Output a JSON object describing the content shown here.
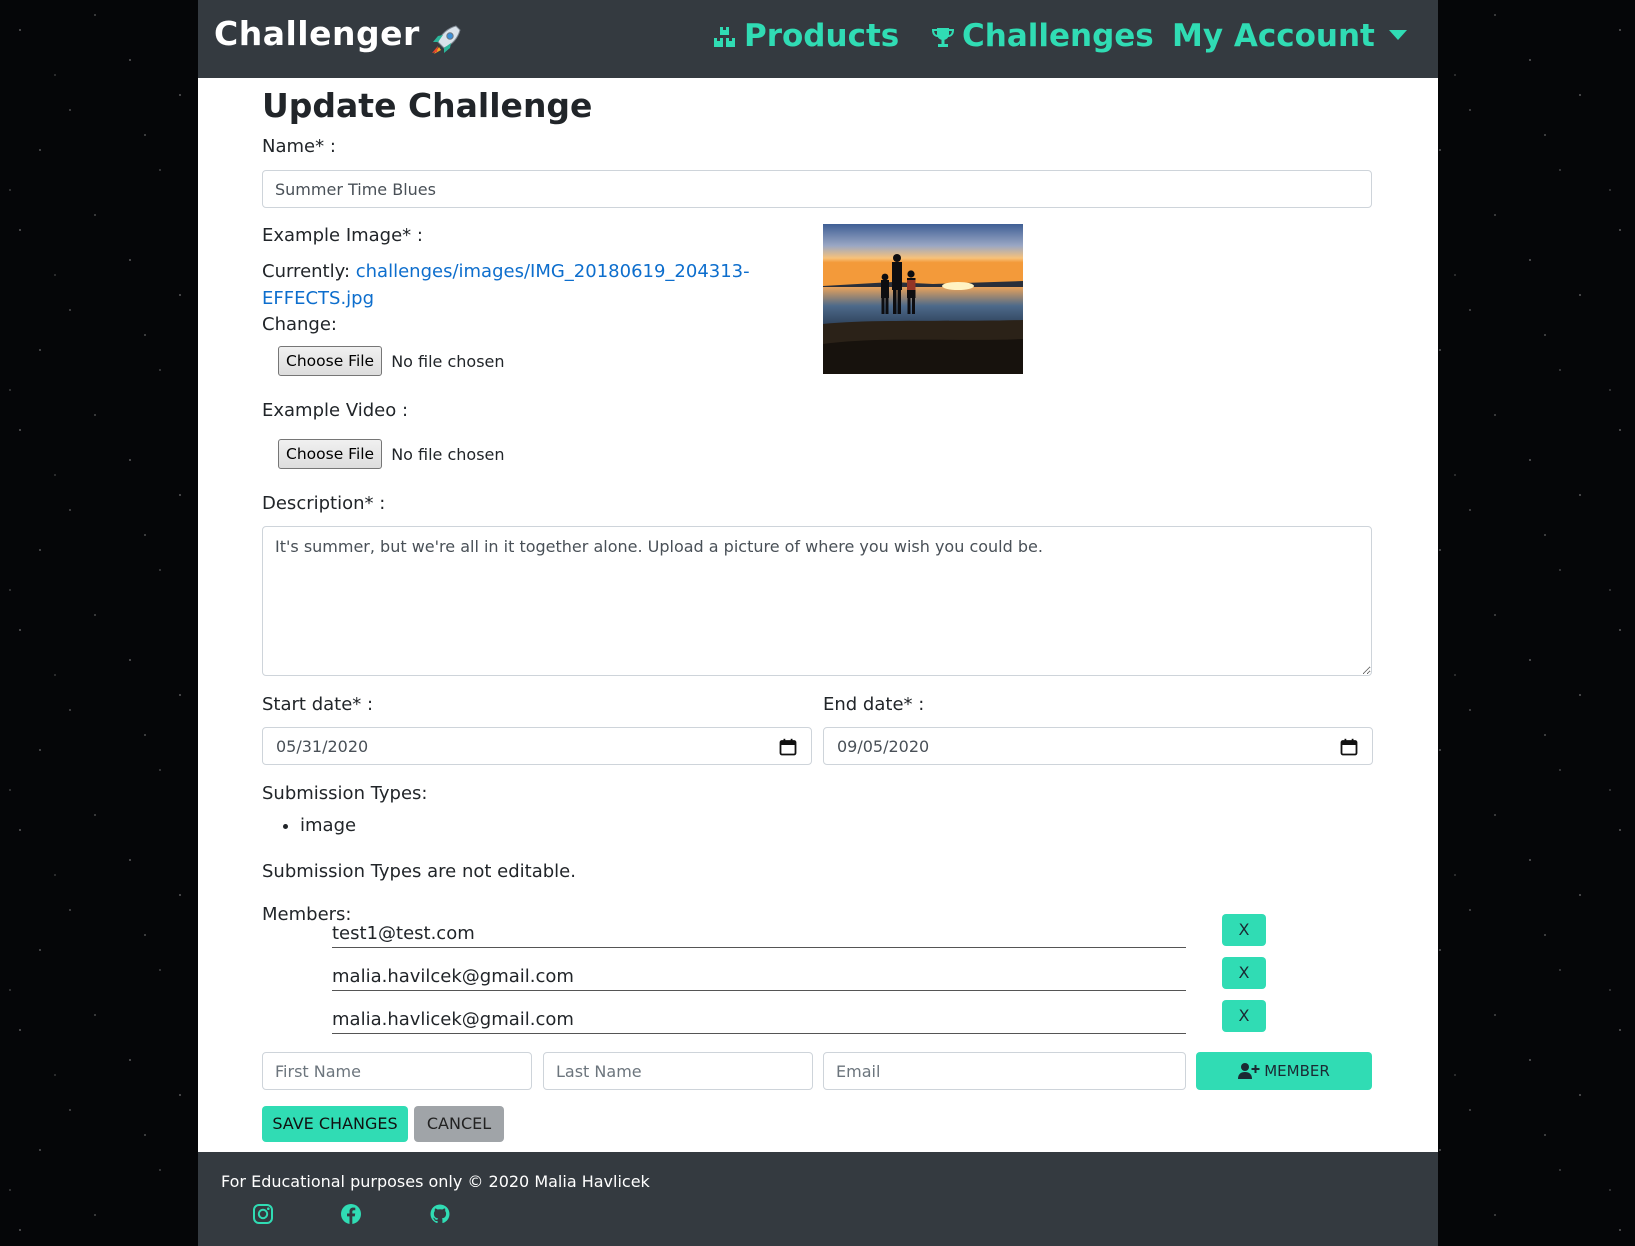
{
  "navbar": {
    "brand": "Challenger",
    "brand_icon": "rocket-icon",
    "links": {
      "products": "Products",
      "challenges": "Challenges",
      "account": "My Account"
    }
  },
  "page_title": "Update Challenge",
  "form": {
    "name_label": "Name* :",
    "name_value": "Summer Time Blues",
    "image_label": "Example Image* :",
    "currently_label": "Currently:",
    "currently_link": "challenges/images/IMG_20180619_204313-EFFECTS.jpg",
    "change_label": "Change:",
    "choose_file": "Choose File",
    "no_file": "No file chosen",
    "video_label": "Example Video :",
    "description_label": "Description* :",
    "description_value": "It's summer, but we're all in it together alone. Upload a picture of where you wish you could be.",
    "start_label": "Start date* :",
    "start_value": "05/31/2020",
    "end_label": "End date* :",
    "end_value": "09/05/2020",
    "submission_label": "Submission Types:",
    "submission_types": [
      "image"
    ],
    "submission_note": "Submission Types are not editable.",
    "members_label": "Members:",
    "members": [
      "test1@test.com",
      "malia.havilcek@gmail.com",
      "malia.havlicek@gmail.com"
    ],
    "remove_label": "X",
    "first_name_placeholder": "First Name",
    "last_name_placeholder": "Last Name",
    "email_placeholder": "Email",
    "add_member_label": "MEMBER",
    "save_label": "SAVE CHANGES",
    "cancel_label": "CANCEL"
  },
  "footer": {
    "text": "For Educational purposes only © 2020 Malia Havlicek",
    "social_icons": [
      "instagram-icon",
      "facebook-icon",
      "github-icon"
    ]
  },
  "colors": {
    "accent": "#30dcb4",
    "navbar_bg": "#343a40",
    "link": "#0d6ecd"
  }
}
